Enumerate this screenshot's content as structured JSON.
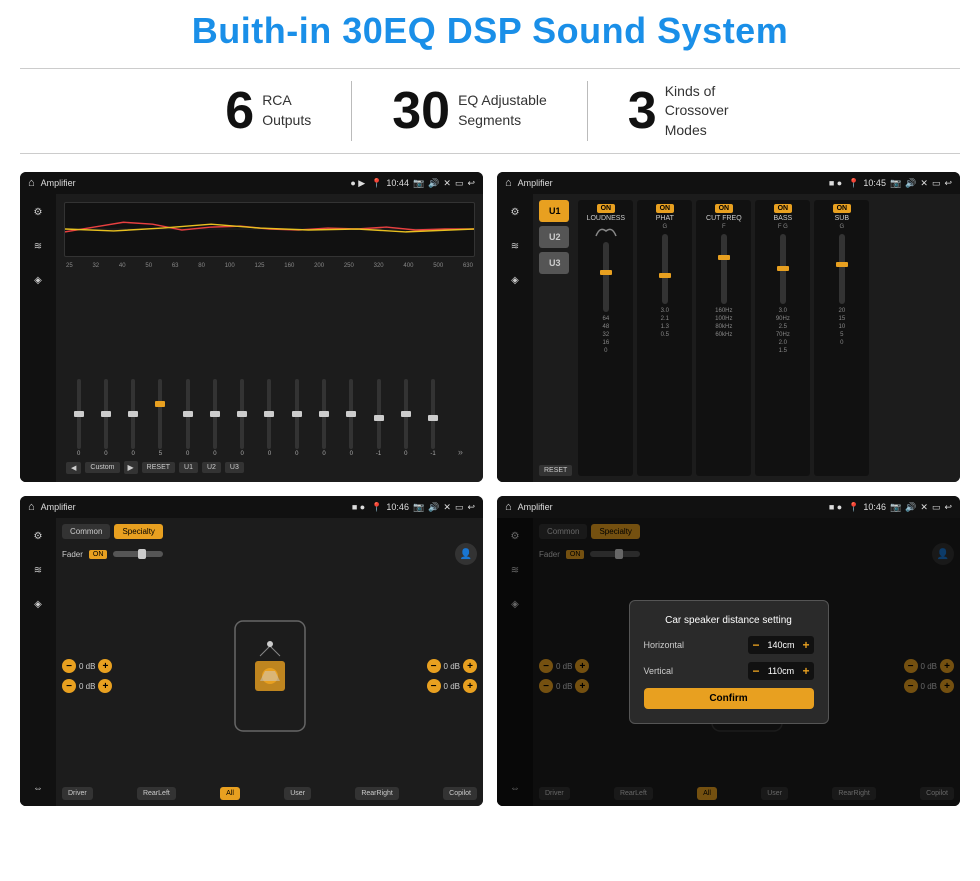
{
  "title": "Buith-in 30EQ DSP Sound System",
  "stats": [
    {
      "number": "6",
      "text": "RCA\nOutputs"
    },
    {
      "number": "30",
      "text": "EQ Adjustable\nSegments"
    },
    {
      "number": "3",
      "text": "Kinds of\nCrossover Modes"
    }
  ],
  "screens": {
    "eq": {
      "topbar": {
        "title": "Amplifier",
        "time": "10:44"
      },
      "frequencies": [
        "25",
        "32",
        "40",
        "50",
        "63",
        "80",
        "100",
        "125",
        "160",
        "200",
        "250",
        "320",
        "400",
        "500",
        "630"
      ],
      "values": [
        "0",
        "0",
        "0",
        "5",
        "0",
        "0",
        "0",
        "0",
        "0",
        "0",
        "0",
        "-1",
        "0",
        "-1"
      ],
      "buttons": [
        "Custom",
        "RESET",
        "U1",
        "U2",
        "U3"
      ]
    },
    "crossover": {
      "topbar": {
        "title": "Amplifier",
        "time": "10:45"
      },
      "panels": [
        {
          "label": "LOUDNESS"
        },
        {
          "label": "PHAT"
        },
        {
          "label": "CUT FREQ"
        },
        {
          "label": "BASS"
        },
        {
          "label": "SUB"
        }
      ],
      "uButtons": [
        "U1",
        "U2",
        "U3"
      ],
      "resetLabel": "RESET"
    },
    "speaker1": {
      "topbar": {
        "title": "Amplifier",
        "time": "10:46"
      },
      "tabs": [
        "Common",
        "Specialty"
      ],
      "faderLabel": "Fader",
      "faderOn": "ON",
      "dBValues": [
        "0 dB",
        "0 dB",
        "0 dB",
        "0 dB"
      ],
      "buttons": [
        "Driver",
        "RearLeft",
        "All",
        "User",
        "RearRight",
        "Copilot"
      ]
    },
    "speaker2": {
      "topbar": {
        "title": "Amplifier",
        "time": "10:46"
      },
      "tabs": [
        "Common",
        "Specialty"
      ],
      "faderOn": "ON",
      "dialog": {
        "title": "Car speaker distance setting",
        "rows": [
          {
            "label": "Horizontal",
            "value": "140cm"
          },
          {
            "label": "Vertical",
            "value": "110cm"
          }
        ],
        "confirmLabel": "Confirm"
      },
      "dBValues": [
        "0 dB",
        "0 dB"
      ],
      "buttons": [
        "Driver",
        "RearLeft",
        "All",
        "User",
        "RearRight",
        "Copilot"
      ]
    }
  }
}
